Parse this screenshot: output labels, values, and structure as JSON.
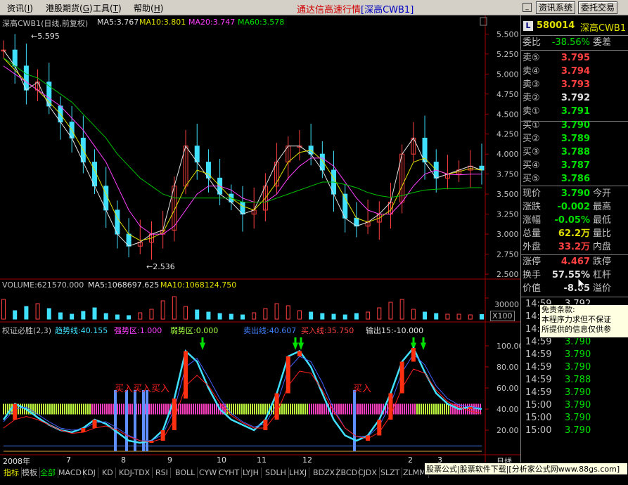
{
  "menu": {
    "items": [
      "资讯",
      "港股期货",
      "工具",
      "帮助"
    ],
    "underlines": [
      "I",
      "G",
      "T",
      "H"
    ]
  },
  "app_title": {
    "main": "通达信高速行情",
    "sub": "[深高CWB1]"
  },
  "toolbar": {
    "info_system": "资讯系统",
    "trade": "委托交易"
  },
  "main_chart": {
    "label": "深高CWB1(日线,前复权)",
    "ma5": "MA5:3.767",
    "ma10": "MA10:3.801",
    "ma20": "MA20:3.747",
    "ma60": "MA60:3.578",
    "high_marker": "5.595",
    "low_marker": "2.536",
    "price_axis": [
      "5.500",
      "5.250",
      "5.000",
      "4.750",
      "4.500",
      "4.250",
      "4.000",
      "3.750",
      "3.500",
      "3.250",
      "3.000",
      "2.750",
      "2.500"
    ]
  },
  "volume_chart": {
    "label": "VOLUME:621570.000",
    "ma5": "MA5:1068697.625",
    "ma10": "MA10:1068124.750",
    "axis_value": "30000",
    "axis_unit": "X100"
  },
  "indicator_chart": {
    "title": "权证必胜(2,3)",
    "trend": "趋势线:40.155",
    "strong": "强势区:1.000",
    "weak": "弱势区:0.000",
    "sell": "卖出线:40.607",
    "buy": "买入线:35.750",
    "output": "输出15:-10.000",
    "axis": [
      "100.00",
      "80.00",
      "60.00",
      "40.00",
      "20.00"
    ],
    "buy_labels": [
      "买入买入买入",
      "买入"
    ]
  },
  "time_axis": [
    "2008年",
    "7",
    "8",
    "9",
    "10",
    "11",
    "12",
    "2",
    "3"
  ],
  "time_axis_end": "日线",
  "quote": {
    "code": "580014",
    "name": "深高CWB1",
    "ratio_label": "委比",
    "ratio_value": "-38.56%",
    "diff_label": "委差",
    "sells": [
      {
        "label": "卖⑤",
        "price": "3.795",
        "color": "#ff4040"
      },
      {
        "label": "卖④",
        "price": "3.794",
        "color": "#ff4040"
      },
      {
        "label": "卖③",
        "price": "3.793",
        "color": "#ff4040"
      },
      {
        "label": "卖②",
        "price": "3.792",
        "color": "#e0e0e0"
      },
      {
        "label": "卖①",
        "price": "3.791",
        "color": "#00e000"
      }
    ],
    "buys": [
      {
        "label": "买①",
        "price": "3.790",
        "color": "#00e000"
      },
      {
        "label": "买②",
        "price": "3.789",
        "color": "#00e000"
      },
      {
        "label": "买③",
        "price": "3.788",
        "color": "#00e000"
      },
      {
        "label": "买④",
        "price": "3.787",
        "color": "#00e000"
      },
      {
        "label": "买⑤",
        "price": "3.786",
        "color": "#00e000"
      }
    ],
    "stats": [
      {
        "k": "现价",
        "v": "3.790",
        "c": "#00e000",
        "k2": "今开"
      },
      {
        "k": "涨跌",
        "v": "-0.002",
        "c": "#00e000",
        "k2": "最高"
      },
      {
        "k": "涨幅",
        "v": "-0.05%",
        "c": "#00e000",
        "k2": "最低"
      },
      {
        "k": "总量",
        "v": "62.2万",
        "c": "#e0e000",
        "k2": "量比"
      },
      {
        "k": "外盘",
        "v": "33.2万",
        "c": "#ff4040",
        "k2": "内盘"
      }
    ],
    "limits": [
      {
        "k": "涨停",
        "v": "4.467",
        "c": "#ff4040",
        "k2": "跌停"
      },
      {
        "k": "换手",
        "v": "57.55%",
        "c": "#e0e0e0",
        "k2": "杠杆"
      },
      {
        "k": "价值",
        "v": "-8.05",
        "c": "#e0e0e0",
        "k2": "溢价"
      }
    ],
    "last_tick": "3.792"
  },
  "ticks": [
    {
      "time": "14:59",
      "price": "3.790"
    },
    {
      "time": "14:59",
      "price": "3.790"
    },
    {
      "time": "14:59",
      "price": "3.790"
    },
    {
      "time": "14:59",
      "price": "3.790"
    },
    {
      "time": "14:59",
      "price": "3.790"
    },
    {
      "time": "14:59",
      "price": "3.788"
    },
    {
      "time": "14:59",
      "price": "3.790"
    },
    {
      "time": "15:00",
      "price": "3.790"
    },
    {
      "time": "15:00",
      "price": "3.790"
    },
    {
      "time": "15:00",
      "price": "3.790"
    }
  ],
  "popup": {
    "title": "免责条款:",
    "line1": "本程序力求但不保证",
    "line2": "所提供的信息仅供参"
  },
  "tabs": [
    "指标",
    "模板",
    "全部",
    "MACD",
    "KDJ",
    "KD",
    "KDJ-TDX",
    "RSI",
    "BOLL",
    "CYW",
    "CYHT",
    "LYJH",
    "SDLH",
    "LHXJ",
    "BDZX",
    "ZBCD",
    "CJDX",
    "SLZT",
    "ZLMM"
  ],
  "status_text": "股票公式|股票软件下载|[分析家公式网www.88gs.com]",
  "chart_data": [
    {
      "type": "line",
      "title": "深高CWB1(日线,前复权)",
      "ylim": [
        2.5,
        5.6
      ],
      "series": [
        {
          "name": "MA5",
          "values": [
            5.3,
            5.1,
            4.8,
            4.9,
            4.6,
            4.4,
            4.2,
            3.9,
            3.6,
            3.3,
            3.0,
            2.85,
            2.9,
            3.0,
            3.05,
            3.6,
            4.1,
            3.9,
            3.7,
            3.5,
            3.4,
            3.25,
            3.3,
            3.6,
            3.9,
            4.1,
            4.1,
            4.0,
            3.8,
            3.5,
            3.2,
            3.1,
            3.15,
            3.25,
            3.4,
            4.0,
            4.2,
            3.9,
            3.7,
            3.75,
            3.8,
            3.85,
            3.8
          ]
        },
        {
          "name": "MA10",
          "values": [
            5.2,
            5.05,
            4.9,
            4.8,
            4.65,
            4.5,
            4.3,
            4.05,
            3.8,
            3.5,
            3.2,
            3.0,
            2.92,
            2.95,
            3.02,
            3.3,
            3.6,
            3.8,
            3.75,
            3.6,
            3.45,
            3.35,
            3.3,
            3.45,
            3.65,
            3.9,
            4.02,
            4.05,
            3.92,
            3.7,
            3.45,
            3.2,
            3.15,
            3.2,
            3.3,
            3.6,
            3.9,
            3.95,
            3.8,
            3.75,
            3.78,
            3.82,
            3.8
          ]
        },
        {
          "name": "MA20",
          "values": [
            5.1,
            5.0,
            4.9,
            4.8,
            4.7,
            4.6,
            4.45,
            4.3,
            4.1,
            3.9,
            3.6,
            3.3,
            3.1,
            3.0,
            3.0,
            3.1,
            3.3,
            3.5,
            3.6,
            3.6,
            3.55,
            3.45,
            3.4,
            3.4,
            3.5,
            3.7,
            3.85,
            3.95,
            3.95,
            3.85,
            3.65,
            3.45,
            3.3,
            3.25,
            3.25,
            3.4,
            3.6,
            3.75,
            3.8,
            3.75,
            3.74,
            3.75,
            3.75
          ]
        },
        {
          "name": "MA60",
          "values": [
            5.2,
            5.1,
            5.0,
            4.95,
            4.85,
            4.75,
            4.65,
            4.5,
            4.35,
            4.2,
            4.0,
            3.85,
            3.7,
            3.6,
            3.5,
            3.45,
            3.45,
            3.45,
            3.45,
            3.45,
            3.45,
            3.4,
            3.4,
            3.4,
            3.45,
            3.5,
            3.55,
            3.6,
            3.65,
            3.65,
            3.62,
            3.58,
            3.52,
            3.48,
            3.46,
            3.48,
            3.52,
            3.55,
            3.56,
            3.57,
            3.57,
            3.58,
            3.58
          ]
        }
      ]
    },
    {
      "type": "bar",
      "title": "VOLUME:621570.000",
      "ylim": [
        0,
        40000
      ],
      "values": [
        28000,
        12000,
        18000,
        22000,
        15000,
        9000,
        7000,
        11000,
        16000,
        8000,
        6000,
        5000,
        9000,
        14000,
        26000,
        32000,
        18000,
        13000,
        10000,
        8000,
        7000,
        6000,
        9000,
        15000,
        22000,
        19000,
        12000,
        10000,
        8000,
        7000,
        6000,
        8000,
        10000,
        16000,
        24000,
        28000,
        14000,
        10000,
        8000,
        7000,
        7000,
        6000,
        6500
      ]
    },
    {
      "type": "line",
      "title": "权证必胜(2,3)",
      "ylim": [
        0,
        110
      ],
      "series": [
        {
          "name": "趋势线",
          "values": [
            30,
            45,
            40,
            32,
            25,
            20,
            18,
            22,
            30,
            26,
            18,
            10,
            8,
            10,
            20,
            50,
            95,
            85,
            60,
            40,
            30,
            25,
            20,
            30,
            55,
            90,
            95,
            80,
            55,
            30,
            15,
            10,
            15,
            30,
            55,
            85,
            98,
            75,
            55,
            45,
            40,
            42,
            40
          ]
        },
        {
          "name": "卖出线",
          "values": [
            28,
            40,
            42,
            35,
            28,
            22,
            20,
            21,
            27,
            28,
            22,
            15,
            10,
            10,
            16,
            40,
            80,
            88,
            70,
            50,
            36,
            28,
            23,
            26,
            45,
            78,
            90,
            85,
            65,
            40,
            22,
            14,
            14,
            24,
            45,
            75,
            92,
            82,
            62,
            50,
            44,
            42,
            41
          ]
        },
        {
          "name": "买入线",
          "values": [
            22,
            30,
            33,
            30,
            25,
            20,
            17,
            18,
            22,
            24,
            20,
            14,
            10,
            9,
            12,
            30,
            62,
            72,
            62,
            46,
            34,
            27,
            22,
            22,
            36,
            62,
            76,
            74,
            58,
            38,
            22,
            14,
            12,
            18,
            34,
            60,
            78,
            74,
            58,
            47,
            42,
            38,
            36
          ]
        }
      ]
    }
  ]
}
